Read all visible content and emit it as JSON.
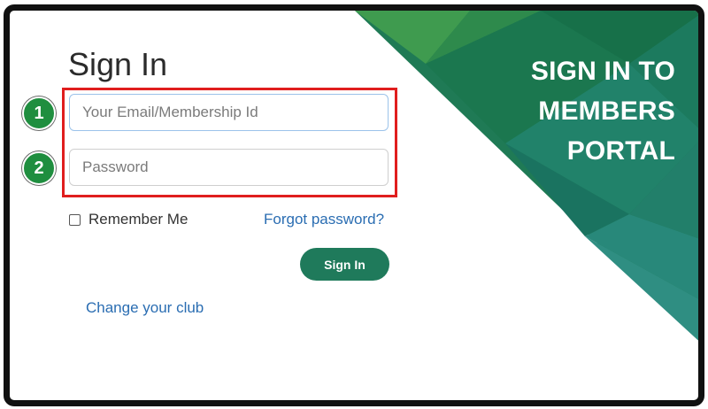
{
  "login": {
    "title": "Sign In",
    "email_placeholder": "Your Email/Membership Id",
    "password_placeholder": "Password",
    "remember_label": "Remember Me",
    "remember_checked": false,
    "forgot_link": "Forgot password?",
    "signin_button": "Sign In",
    "change_club_link": "Change your club"
  },
  "annotations": {
    "step1": "1",
    "step2": "2"
  },
  "promo": {
    "line1": "SIGN IN TO",
    "line2": "MEMBERS",
    "line3": "PORTAL"
  },
  "colors": {
    "accent_green": "#1f7a5b",
    "badge_green": "#1f8e3f",
    "link_blue": "#2a6db2",
    "highlight_red": "#e01e1e"
  }
}
